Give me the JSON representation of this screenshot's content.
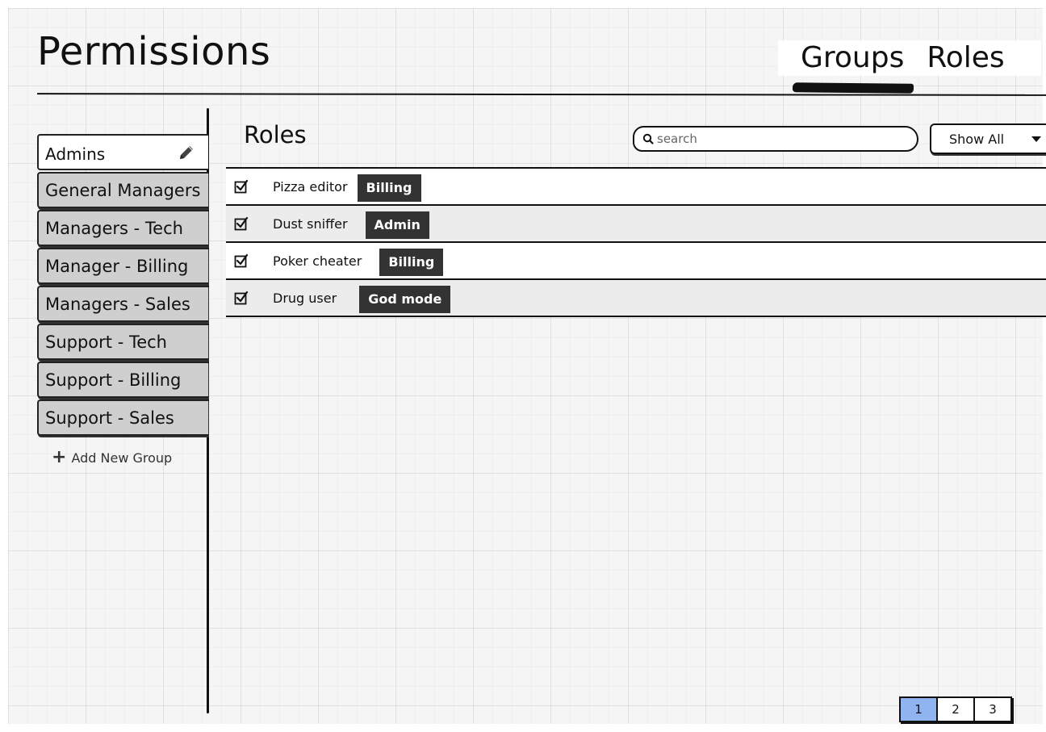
{
  "header": {
    "title": "Permissions",
    "tabs": [
      {
        "label": "Groups",
        "active": true
      },
      {
        "label": "Roles",
        "active": false
      }
    ]
  },
  "sidebar": {
    "selected_group": "Admins",
    "groups": [
      "General Managers",
      "Managers - Tech",
      "Manager - Billing",
      "Managers - Sales",
      "Support - Tech",
      "Support - Billing",
      "Support - Sales"
    ],
    "add_group_label": "Add New Group"
  },
  "main": {
    "title": "Roles",
    "search": {
      "placeholder": "search",
      "value": ""
    },
    "filter": {
      "selected": "Show All"
    },
    "roles": [
      {
        "name": "Pizza editor",
        "checked": true,
        "tag": "Billing"
      },
      {
        "name": "Dust sniffer",
        "checked": true,
        "tag": "Admin"
      },
      {
        "name": "Poker cheater",
        "checked": true,
        "tag": "Billing"
      },
      {
        "name": "Drug user",
        "checked": true,
        "tag": "God mode"
      }
    ]
  },
  "pagination": {
    "pages": [
      "1",
      "2",
      "3"
    ],
    "current": "1"
  },
  "colors": {
    "tag_background": "#333333",
    "current_page": "#8fb4f0",
    "tab_inactive": "#cfcfcf",
    "grid_background": "#f5f5f5"
  },
  "icons": {
    "edit": "pencil-icon",
    "search": "search-icon",
    "add": "plus-icon",
    "dropdown": "caret-down-icon",
    "checkbox": "checkbox-icon"
  }
}
